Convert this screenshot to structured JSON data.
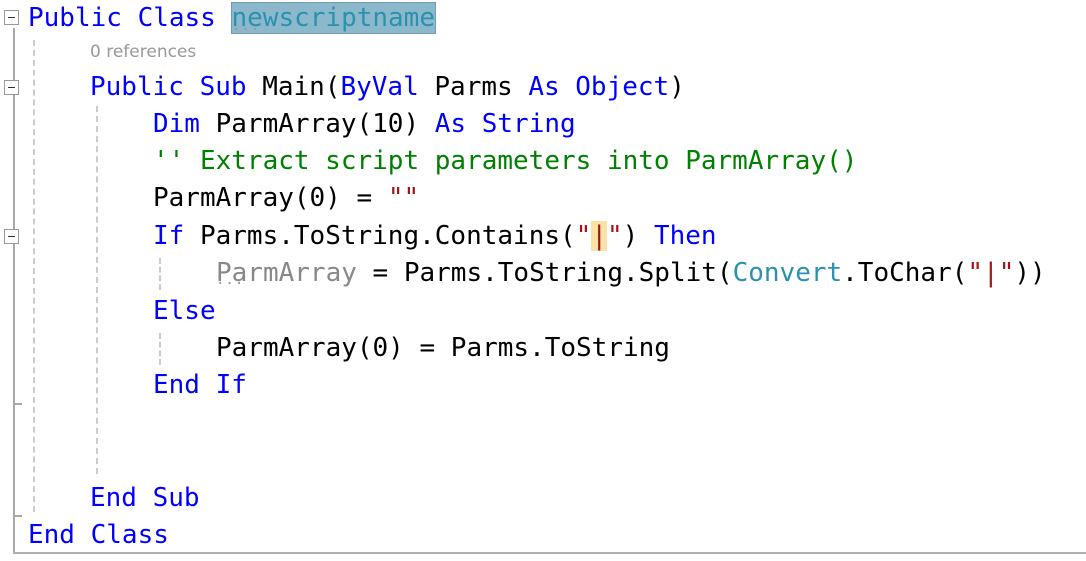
{
  "editor": {
    "codelens": "0 references",
    "lines": [
      [
        {
          "t": "Public Class ",
          "c": "kw"
        },
        {
          "t": "newscriptname",
          "c": "hl"
        }
      ],
      [
        {
          "t": "Public Sub ",
          "c": "kw"
        },
        {
          "t": "Main(",
          "c": ""
        },
        {
          "t": "ByVal ",
          "c": "kw"
        },
        {
          "t": "Parms ",
          "c": ""
        },
        {
          "t": "As Object",
          "c": "kw"
        },
        {
          "t": ")",
          "c": ""
        }
      ],
      [
        {
          "t": "Dim ",
          "c": "kw"
        },
        {
          "t": "ParmArray(10) ",
          "c": ""
        },
        {
          "t": "As String",
          "c": "kw"
        }
      ],
      [
        {
          "t": "'' Extract script parameters into ParmArray()",
          "c": "cm"
        }
      ],
      [
        {
          "t": "ParmArray(0) = ",
          "c": ""
        },
        {
          "t": "\"\"",
          "c": "st"
        }
      ],
      [
        {
          "t": "If ",
          "c": "kw"
        },
        {
          "t": "Parms.ToString.Contains(",
          "c": ""
        },
        {
          "t": "\"",
          "c": "st"
        },
        {
          "t": "|",
          "c": "st bm"
        },
        {
          "t": "\"",
          "c": "st"
        },
        {
          "t": ") ",
          "c": ""
        },
        {
          "t": "Then",
          "c": "kw"
        }
      ],
      [
        {
          "t": "ParmArray",
          "c": "un"
        },
        {
          "t": " = Parms.ToString.Split(",
          "c": ""
        },
        {
          "t": "Convert",
          "c": "ty"
        },
        {
          "t": ".ToChar(",
          "c": ""
        },
        {
          "t": "\"|\"",
          "c": "st"
        },
        {
          "t": "))",
          "c": ""
        }
      ],
      [
        {
          "t": "Else",
          "c": "kw"
        }
      ],
      [
        {
          "t": "ParmArray(0) = Parms.ToString",
          "c": ""
        }
      ],
      [
        {
          "t": "End If",
          "c": "kw"
        }
      ],
      [
        {
          "t": "End Sub",
          "c": "kw"
        }
      ],
      [
        {
          "t": "End Class",
          "c": "kw"
        }
      ]
    ],
    "colors": {
      "keyword": "#0000ff",
      "comment": "#008000",
      "type": "#2b91af",
      "string": "#a31515",
      "unused": "#888888",
      "highlight": "#8cb8cc",
      "brace_match": "#fbe3a8"
    }
  }
}
